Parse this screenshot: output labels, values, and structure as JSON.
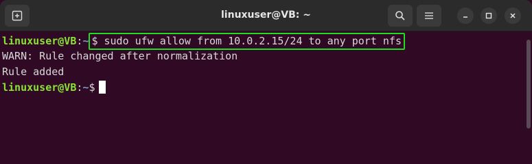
{
  "window": {
    "title": "linuxuser@VB: ~"
  },
  "titlebar": {
    "new_tab_icon": "new-tab-icon",
    "search_icon": "search-icon",
    "menu_icon": "hamburger-menu-icon",
    "minimize_icon": "minimize-icon",
    "maximize_icon": "maximize-icon",
    "close_icon": "close-icon"
  },
  "terminal": {
    "colors": {
      "background": "#300a24",
      "user": "#8ae234",
      "path": "#729fcf",
      "text": "#d8d8d8",
      "highlight_border": "#22dd22"
    },
    "lines": [
      {
        "user": "linuxuser@VB",
        "sep": ":",
        "path": "~",
        "cmd": "$ sudo ufw allow from 10.0.2.15/24 to any port nfs"
      },
      {
        "output": "WARN: Rule changed after normalization"
      },
      {
        "output": "Rule added"
      },
      {
        "user": "linuxuser@VB",
        "sep": ":",
        "path": "~",
        "prompt_symbol": "$"
      }
    ]
  }
}
